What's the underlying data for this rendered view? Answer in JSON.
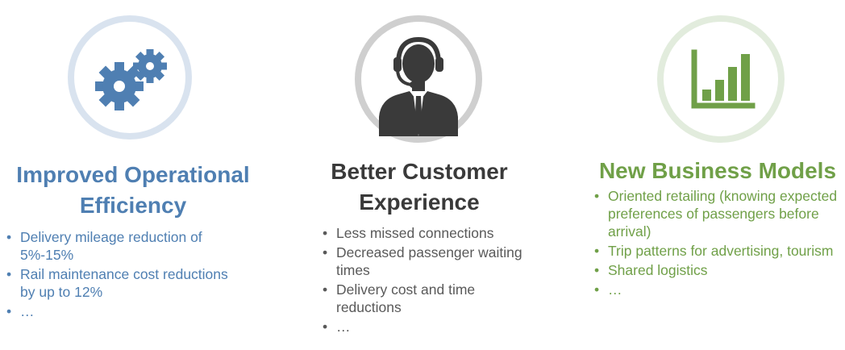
{
  "columns": [
    {
      "icon": "gears-icon",
      "accent": "#4f7fb2",
      "title_line1": "Improved Operational",
      "title_line2": "Efficiency",
      "bullets": [
        "Delivery mileage reduction of 5%-15%",
        "Rail maintenance cost reductions by up to 12%",
        "…"
      ]
    },
    {
      "icon": "customer-support-headset-icon",
      "accent": "#3a3a3a",
      "title_line1": "Better Customer",
      "title_line2": "Experience",
      "bullets": [
        "Less missed connections",
        "Decreased passenger waiting times",
        "Delivery cost and time reductions",
        "…"
      ]
    },
    {
      "icon": "bar-chart-icon",
      "accent": "#70a048",
      "title_line1": "New Business Models",
      "bullets": [
        "Oriented retailing (knowing expected preferences of passengers before arrival)",
        "Trip patterns for advertising, tourism",
        "Shared logistics",
        "…"
      ]
    }
  ]
}
